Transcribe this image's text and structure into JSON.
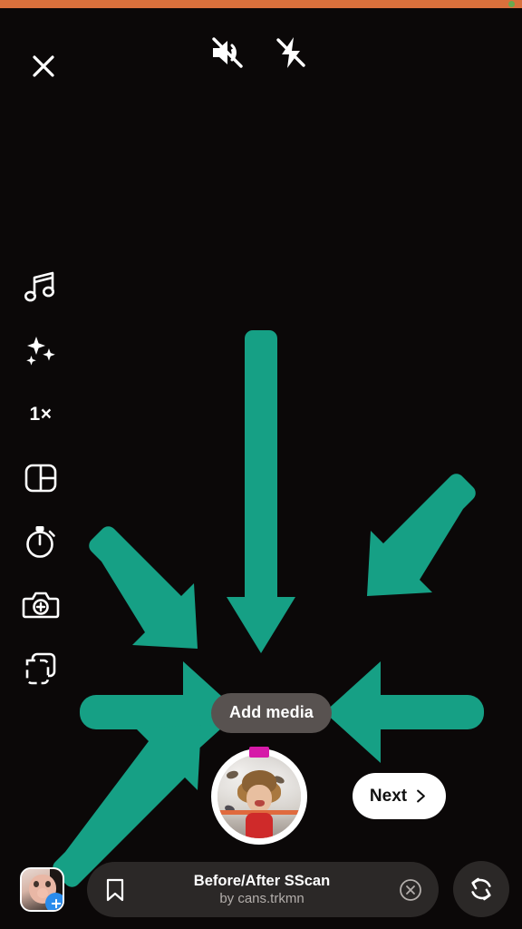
{
  "theme": {
    "accent_orange": "#d9703c",
    "status_dot_green": "#6aa84f",
    "arrow_teal": "#16a085",
    "pill_gray": "#585250",
    "bottom_pill_gray": "#2b2827",
    "badge_blue": "#2a8ced",
    "shutter_tick_magenta": "#d61aa8"
  },
  "status_bar": {
    "dot_name": "recording-indicator-dot"
  },
  "top_controls": {
    "close_label": "close-icon",
    "items": [
      {
        "name": "sound-off-icon",
        "label": "Sound off"
      },
      {
        "name": "flash-off-icon",
        "label": "Flash off"
      }
    ]
  },
  "tool_rail": {
    "items": [
      {
        "name": "music-icon",
        "label": "Music"
      },
      {
        "name": "effects-icon",
        "label": "Effects"
      },
      {
        "name": "zoom-level",
        "label": "1×"
      },
      {
        "name": "layout-icon",
        "label": "Layout"
      },
      {
        "name": "timer-icon",
        "label": "Timer"
      },
      {
        "name": "add-photo-icon",
        "label": "Photo"
      },
      {
        "name": "templates-icon",
        "label": "Templates"
      }
    ]
  },
  "annotations": {
    "arrow_count": 6,
    "target": "Add media",
    "color": "#16a085"
  },
  "capture": {
    "add_media_label": "Add media",
    "shutter_label": "Record",
    "next_label": "Next"
  },
  "bottom_bar": {
    "gallery_label": "Gallery",
    "gallery_badge": "+",
    "audio": {
      "title": "Before/After SScan",
      "subtitle": "by cans.trkmn",
      "save_icon": "bookmark-icon",
      "dismiss_icon": "close-circle-icon"
    },
    "flip_label": "Flip camera"
  }
}
